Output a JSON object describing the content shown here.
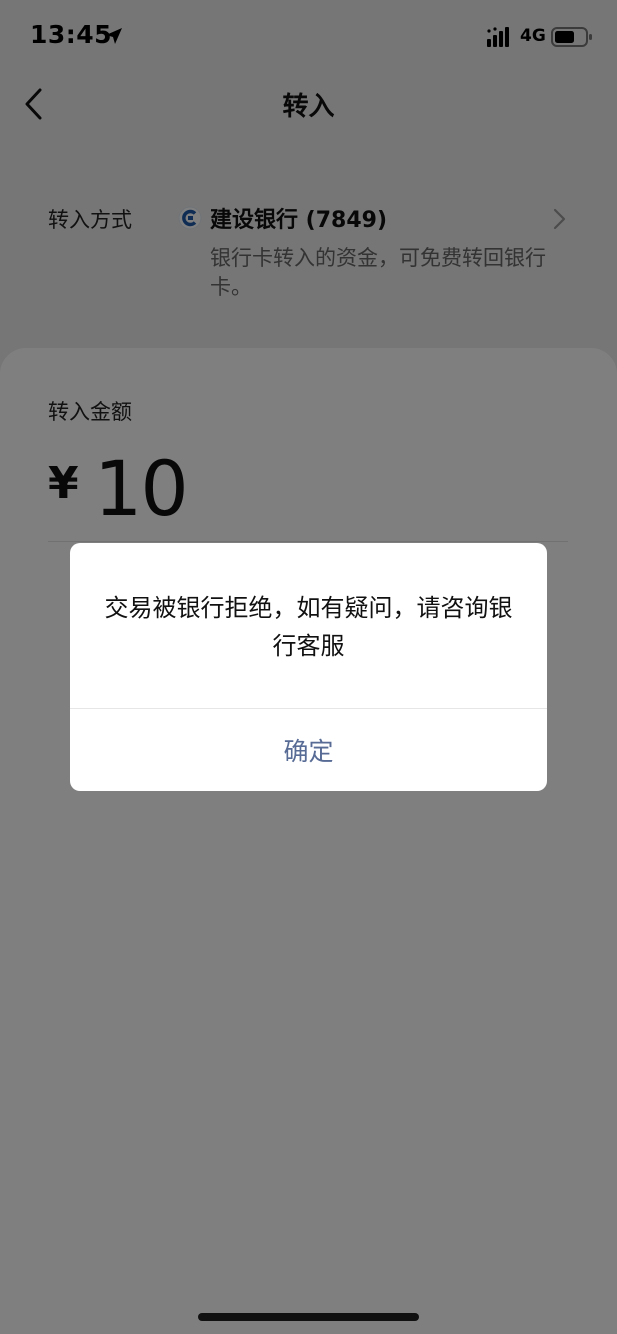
{
  "status_bar": {
    "time": "13:45",
    "network": "4G"
  },
  "nav": {
    "title": "转入"
  },
  "transfer_method": {
    "label": "转入方式",
    "bank_name": "建设银行 (7849)",
    "description": "银行卡转入的资金，可免费转回银行卡。"
  },
  "amount": {
    "label": "转入金额",
    "currency": "¥",
    "value": "10"
  },
  "dialog": {
    "message": "交易被银行拒绝，如有疑问，请咨询银行客服",
    "confirm_label": "确定"
  },
  "colors": {
    "dialog_button": "#576b95",
    "bank_logo": "#1e5aa8"
  }
}
